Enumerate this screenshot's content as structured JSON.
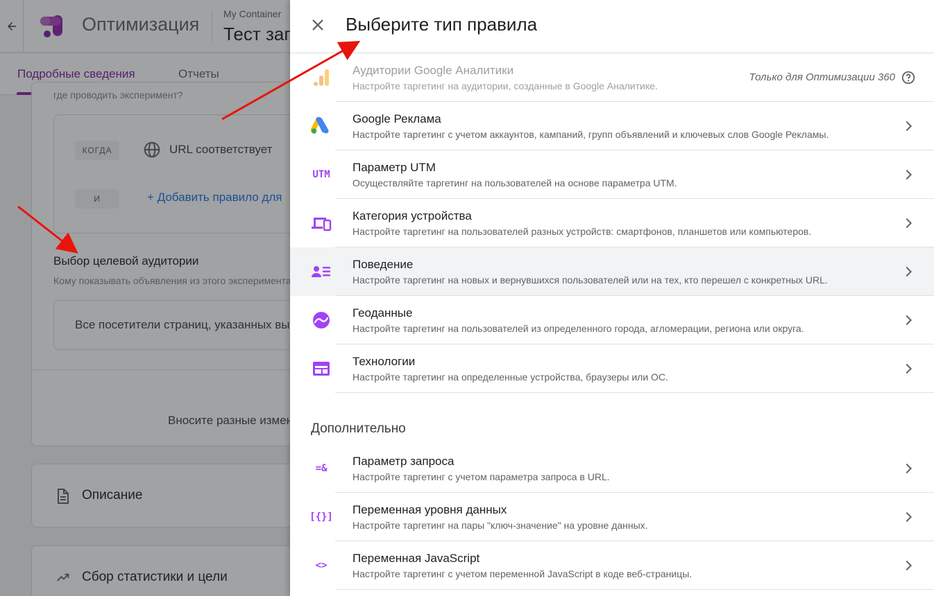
{
  "background": {
    "back_icon": "arrow-left-icon",
    "product_name": "Оптимизация",
    "container_name": "My Container",
    "experiment_title": "Тест заголовка",
    "tabs": [
      {
        "label": "Подробные сведения",
        "active": true
      },
      {
        "label": "Отчеты",
        "active": false
      }
    ],
    "cut_text": "где проводить эксперимент?",
    "when_chip": "КОГДА",
    "and_chip": "И",
    "url_condition": "URL соответствует",
    "add_rule": "+ Добавить правило для",
    "audience_title": "Выбор целевой аудитории",
    "audience_subtitle": "Кому показывать объявления из этого эксперимента",
    "audience_value": "Все посетители страниц, указанных выше",
    "bottom_text": "Вносите разные изменения",
    "description_card": {
      "title": "Описание",
      "icon": "document-icon"
    },
    "stats_card": {
      "title": "Сбор статистики и цели",
      "icon": "trending-up-icon"
    }
  },
  "drawer": {
    "title": "Выберите тип правила",
    "close_icon": "close-icon",
    "rules": [
      {
        "title": "Аудитории Google Аналитики",
        "desc": "Настройте таргетинг на аудитории, созданные в Google Аналитике.",
        "icon": "analytics-icon",
        "disabled": true,
        "note": "Только для Оптимизации 360"
      },
      {
        "title": "Google Реклама",
        "desc": "Настройте таргетинг с учетом аккаунтов, кампаний, групп объявлений и ключевых слов Google Рекламы.",
        "icon": "google-ads-icon"
      },
      {
        "title": "Параметр UTM",
        "desc": "Осуществляйте таргетинг на пользователей на основе параметра UTM.",
        "icon": "utm-icon",
        "icon_text": "UTM"
      },
      {
        "title": "Категория устройства",
        "desc": "Настройте таргетинг на пользователей разных устройств: смартфонов, планшетов или компьютеров.",
        "icon": "devices-icon"
      },
      {
        "title": "Поведение",
        "desc": "Настройте таргетинг на новых и вернувшихся пользователей или на тех, кто перешел с конкретных URL.",
        "icon": "behavior-icon",
        "highlighted": true
      },
      {
        "title": "Геоданные",
        "desc": "Настройте таргетинг на пользователей из определенного города, агломерации, региона или округа.",
        "icon": "geo-icon"
      },
      {
        "title": "Технологии",
        "desc": "Настройте таргетинг на определенные устройства, браузеры или ОС.",
        "icon": "technology-icon"
      }
    ],
    "advanced_label": "Дополнительно",
    "advanced_rules": [
      {
        "title": "Параметр запроса",
        "desc": "Настройте таргетинг с учетом параметра запроса в URL.",
        "icon": "query-param-icon",
        "icon_text": "=&"
      },
      {
        "title": "Переменная уровня данных",
        "desc": "Настройте таргетинг на пары \"ключ-значение\" на уровне данных.",
        "icon": "datalayer-icon",
        "icon_text": "[{}]"
      },
      {
        "title": "Переменная JavaScript",
        "desc": "Настройте таргетинг с учетом переменной JavaScript в коде веб-страницы.",
        "icon": "javascript-icon",
        "icon_text": "<>"
      }
    ]
  },
  "colors": {
    "accent_purple": "#a142f4",
    "tab_active": "#7b1fa2",
    "link_blue": "#1a73e8",
    "annotation_red": "#e8140c"
  }
}
